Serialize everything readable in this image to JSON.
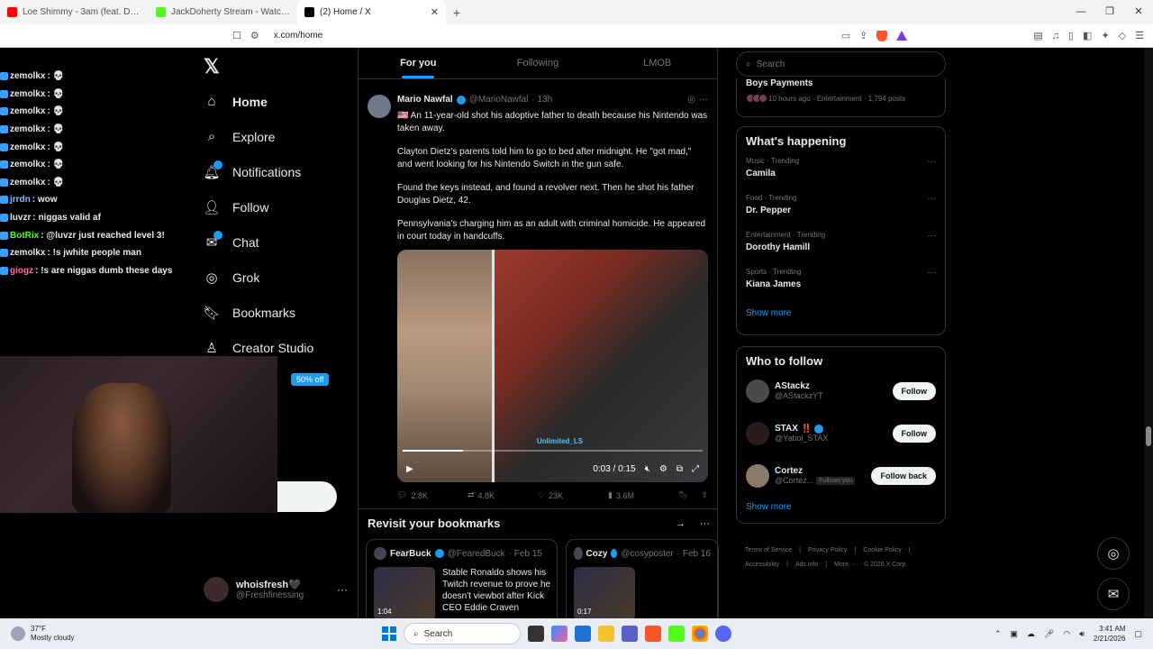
{
  "browser": {
    "tabs": [
      {
        "label": "Loe Shimmy - 3am (feat. Don Toliver)",
        "color": "#ff0000"
      },
      {
        "label": "JackDoherty Stream - Watch Live on",
        "color": "#53fc18"
      },
      {
        "label": "(2) Home / X",
        "color": "#000000"
      }
    ],
    "url": "x.com/home"
  },
  "chat": [
    {
      "user": "zemolkx",
      "msg": ": 💀",
      "color": "#e7e9ea"
    },
    {
      "user": "zemolkx",
      "msg": ": 💀",
      "color": "#e7e9ea"
    },
    {
      "user": "zemolkx",
      "msg": ": 💀",
      "color": "#e7e9ea"
    },
    {
      "user": "zemolkx",
      "msg": ": 💀",
      "color": "#e7e9ea"
    },
    {
      "user": "zemolkx",
      "msg": ": 💀",
      "color": "#e7e9ea"
    },
    {
      "user": "zemolkx",
      "msg": ": 💀",
      "color": "#e7e9ea"
    },
    {
      "user": "zemolkx",
      "msg": ": 💀",
      "color": "#e7e9ea"
    },
    {
      "user": "jrrdn",
      "msg": ": wow",
      "color": "#8fb8ff"
    },
    {
      "user": "luvzr",
      "msg": ": niggas valid af",
      "color": "#e7e9ea"
    },
    {
      "user": "BotRix",
      "msg": ": @luvzr just reached level 3!",
      "color": "#53fc18"
    },
    {
      "user": "zemolkx",
      "msg": ": !s jwhite people man",
      "color": "#e7e9ea"
    },
    {
      "user": "giogz",
      "msg": ": !s are niggas dumb these days",
      "color": "#ff6b9a"
    }
  ],
  "nav": {
    "items": [
      {
        "label": "Home",
        "icon": "⌂"
      },
      {
        "label": "Explore",
        "icon": "⌕"
      },
      {
        "label": "Notifications",
        "icon": "🔔︎"
      },
      {
        "label": "Follow",
        "icon": "👤︎"
      },
      {
        "label": "Chat",
        "icon": "✉"
      },
      {
        "label": "Grok",
        "icon": "◎"
      },
      {
        "label": "Bookmarks",
        "icon": "🔖︎"
      },
      {
        "label": "Creator Studio",
        "icon": "♙"
      }
    ],
    "premium_badge": "50% off",
    "profile_name": "whoisfresh🖤",
    "profile_handle": "@Freshfinessing"
  },
  "feed_tabs": [
    "For you",
    "Following",
    "LMOB"
  ],
  "tweet": {
    "name": "Mario Nawfal",
    "handle": "@MarioNawfal",
    "time": "· 13h",
    "p1": "🇺🇸 An 11-year-old shot his adoptive father to death because his Nintendo was taken away.",
    "p2": "Clayton Dietz's parents told him to go to bed after midnight. He \"got mad,\" and went looking for his Nintendo Switch in the gun safe.",
    "p3": "Found the keys instead, and found a revolver next. Then he shot his father Douglas Dietz, 42.",
    "p4": "Pennsylvania's charging him as an adult with criminal homicide. He appeared in court today in handcuffs.",
    "video_watermark": "Unlimited_LS",
    "video_time": "0:03 / 0:15",
    "video_progress": 0.2,
    "replies": "2.8K",
    "reposts": "4.8K",
    "likes": "23K",
    "views": "3.6M"
  },
  "revisit": {
    "title": "Revisit your bookmarks",
    "cards": [
      {
        "name": "FearBuck",
        "handle": "@FearedBuck",
        "date": "· Feb 15",
        "duration": "1:04",
        "text": "Stable Ronaldo shows his Twitch revenue to prove he doesn't viewbot after Kick CEO Eddie Craven"
      },
      {
        "name": "Cozy",
        "handle": "@cosyposter",
        "date": "· Feb 16",
        "duration": "0:17",
        "text": ""
      }
    ]
  },
  "right": {
    "search_placeholder": "Search",
    "boys_title": "Boys Payments",
    "boys_meta": "10 hours ago · Entertainment · 1,794 posts",
    "whats_happening": "What's happening",
    "trends": [
      {
        "meta": "Music · Trending",
        "name": "Camila"
      },
      {
        "meta": "Food · Trending",
        "name": "Dr. Pepper"
      },
      {
        "meta": "Entertainment · Trending",
        "name": "Dorothy Hamill"
      },
      {
        "meta": "Sports · Trending",
        "name": "Kiana James"
      }
    ],
    "show_more": "Show more",
    "who_to_follow": "Who to follow",
    "follow_suggestions": [
      {
        "name": "AStackz",
        "handle": "@AStackzYT",
        "button": "Follow",
        "extra": "",
        "follows_you": ""
      },
      {
        "name": "STAX",
        "handle": "@Yabol_STAX",
        "button": "Follow",
        "extra": "‼️",
        "follows_you": ""
      },
      {
        "name": "Cortez",
        "handle": "@Cortez...",
        "button": "Follow back",
        "extra": "",
        "follows_you": "Follows you"
      }
    ],
    "show_more2": "Show more",
    "footer_line1": [
      "Terms of Service",
      "|",
      "Privacy Policy",
      "|",
      "Cookie Policy",
      "|"
    ],
    "footer_line2": [
      "Accessibility",
      "|",
      "Ads info",
      "|",
      "More ···",
      "© 2026 X Corp."
    ]
  },
  "taskbar": {
    "temp": "37°F",
    "weather": "Mostly cloudy",
    "search": "Search",
    "time": "3:41 AM",
    "date": "2/21/2026"
  }
}
